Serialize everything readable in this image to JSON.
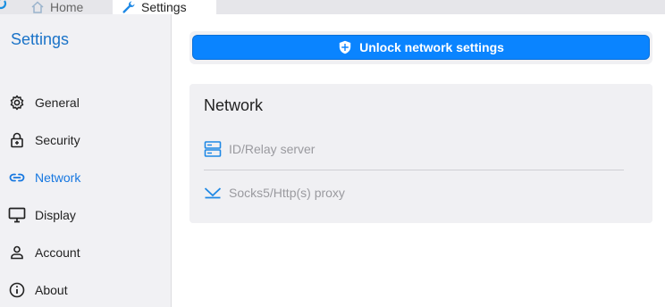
{
  "tabs": [
    {
      "label": "Home"
    },
    {
      "label": "Settings"
    }
  ],
  "sidebar": {
    "title": "Settings",
    "items": [
      {
        "label": "General",
        "icon": "gear-icon"
      },
      {
        "label": "Security",
        "icon": "lock-icon"
      },
      {
        "label": "Network",
        "icon": "link-icon",
        "active": true
      },
      {
        "label": "Display",
        "icon": "monitor-icon"
      },
      {
        "label": "Account",
        "icon": "person-icon"
      },
      {
        "label": "About",
        "icon": "info-icon"
      }
    ]
  },
  "main": {
    "unlock_label": "Unlock network settings",
    "section_title": "Network",
    "items": [
      {
        "label": "ID/Relay server",
        "icon": "server-icon"
      },
      {
        "label": "Socks5/Http(s) proxy",
        "icon": "proxy-icon"
      }
    ]
  },
  "colors": {
    "accent": "#0a84ff",
    "active_nav": "#1677e0",
    "sidebar_bg": "#f1f1f4",
    "disabled_text": "#9a9a9f"
  }
}
